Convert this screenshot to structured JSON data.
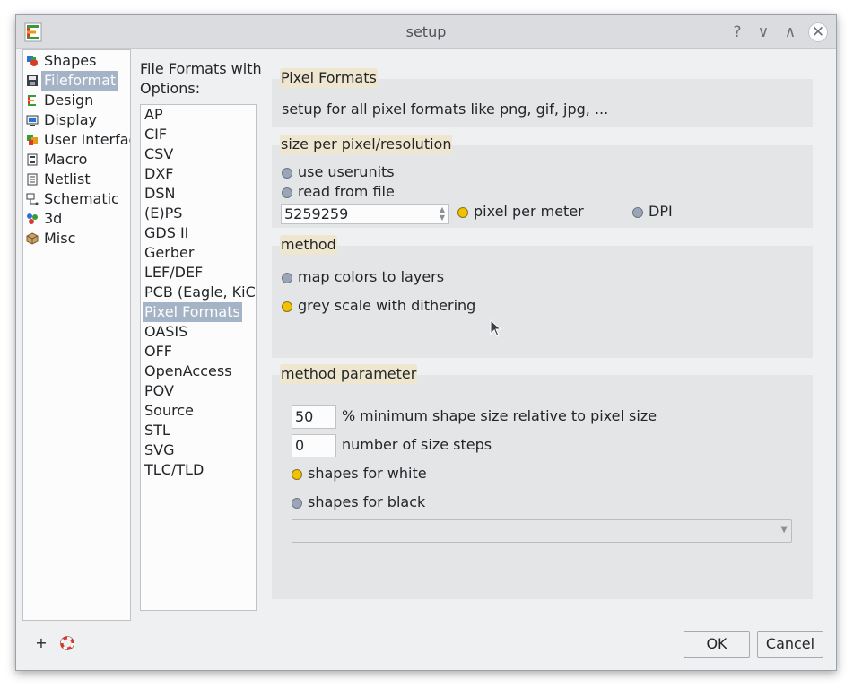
{
  "window": {
    "title": "setup"
  },
  "titlebar": {
    "help_glyph": "?",
    "minimize_glyph": "∨",
    "maximize_glyph": "∧",
    "close_glyph": "✕"
  },
  "nav": {
    "items": [
      {
        "label": "Shapes",
        "icon": "shapes-icon"
      },
      {
        "label": "Fileformat",
        "icon": "floppy-disk-icon",
        "selected": true
      },
      {
        "label": "Design",
        "icon": "design-icon"
      },
      {
        "label": "Display",
        "icon": "display-icon"
      },
      {
        "label": "User Interface",
        "icon": "user-interface-icon"
      },
      {
        "label": "Macro",
        "icon": "macro-icon"
      },
      {
        "label": "Netlist",
        "icon": "netlist-icon"
      },
      {
        "label": "Schematic",
        "icon": "schematic-icon"
      },
      {
        "label": "3d",
        "icon": "3d-icon"
      },
      {
        "label": "Misc",
        "icon": "misc-icon"
      }
    ]
  },
  "formats": {
    "header": "File Formats with Options:",
    "items": [
      "AP",
      "CIF",
      "CSV",
      "DXF",
      "DSN",
      "(E)PS",
      "GDS II",
      "Gerber",
      "LEF/DEF",
      "PCB (Eagle, KiCad",
      "Pixel Formats",
      "OASIS",
      "OFF",
      "OpenAccess",
      "POV",
      "Source",
      "STL",
      "SVG",
      "TLC/TLD"
    ],
    "selected": "Pixel Formats"
  },
  "pixel_formats": {
    "title": "Pixel Formats",
    "description": "setup for all pixel formats like png, gif, jpg, ..."
  },
  "resolution": {
    "title": "size per pixel/resolution",
    "use_userunits": "use userunits",
    "read_from_file": "read from file",
    "value": "5259259",
    "pixel_per_meter": "pixel per meter",
    "dpi": "DPI",
    "selected_unit": "pixel per meter"
  },
  "method": {
    "title": "method",
    "map_colors": "map colors to layers",
    "grey_scale": "grey scale with dithering",
    "selected": "grey scale with dithering"
  },
  "method_parameter": {
    "title": "method parameter",
    "min_size_value": "50",
    "min_size_unit": "%",
    "min_size_label": "minimum shape size relative to pixel size",
    "steps_value": "0",
    "steps_label": "number of size steps",
    "white": "shapes for white",
    "black": "shapes for black",
    "selected": "shapes for white",
    "combo_value": ""
  },
  "buttons": {
    "ok": "OK",
    "cancel": "Cancel",
    "add_glyph": "+",
    "help_glyph": "⛑"
  }
}
